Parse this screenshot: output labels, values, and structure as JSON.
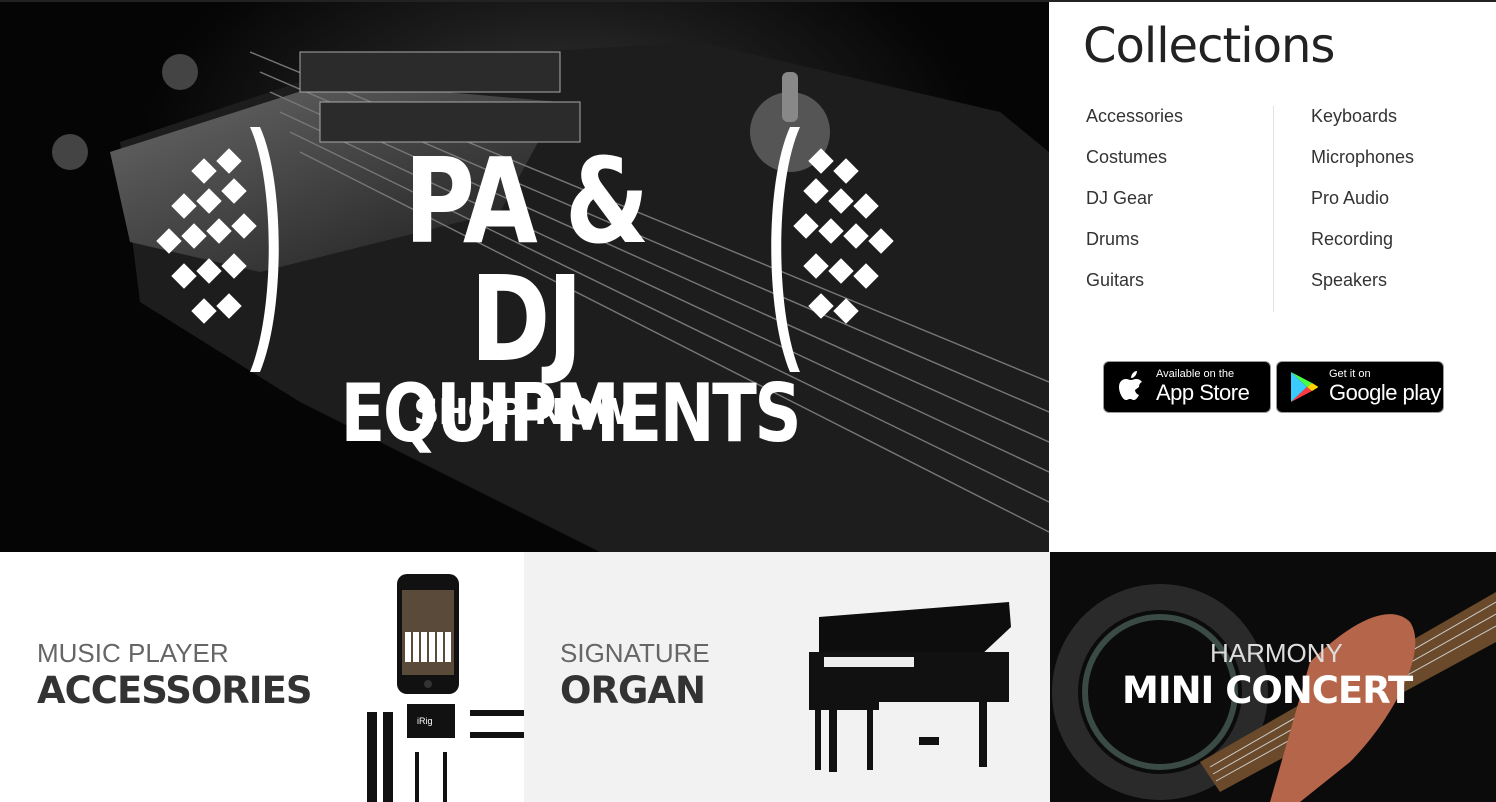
{
  "hero": {
    "title_line1": "PA & DJ",
    "title_line2": "EQUIPMENTS",
    "cta": "SHOP NOW"
  },
  "collections": {
    "title": "Collections",
    "left": [
      "Accessories",
      "Costumes",
      "DJ Gear",
      "Drums",
      "Guitars"
    ],
    "right": [
      "Keyboards",
      "Microphones",
      "Pro Audio",
      "Recording",
      "Speakers"
    ]
  },
  "apps": {
    "appstore_small": "Available on the",
    "appstore_big": "App Store",
    "gplay_small": "Get it on",
    "gplay_big": "Google play"
  },
  "banners": [
    {
      "sub": "MUSIC PLAYER",
      "main": "ACCESSORIES"
    },
    {
      "sub": "SIGNATURE",
      "main": "ORGAN"
    },
    {
      "sub": "HARMONY",
      "main": "MINI CONCERT"
    }
  ],
  "icons": [
    "apple-icon",
    "google-play-icon",
    "laurel-icon",
    "piano-icon",
    "phone-icon"
  ],
  "colors": {
    "accent": "#000000",
    "text": "#333333"
  }
}
